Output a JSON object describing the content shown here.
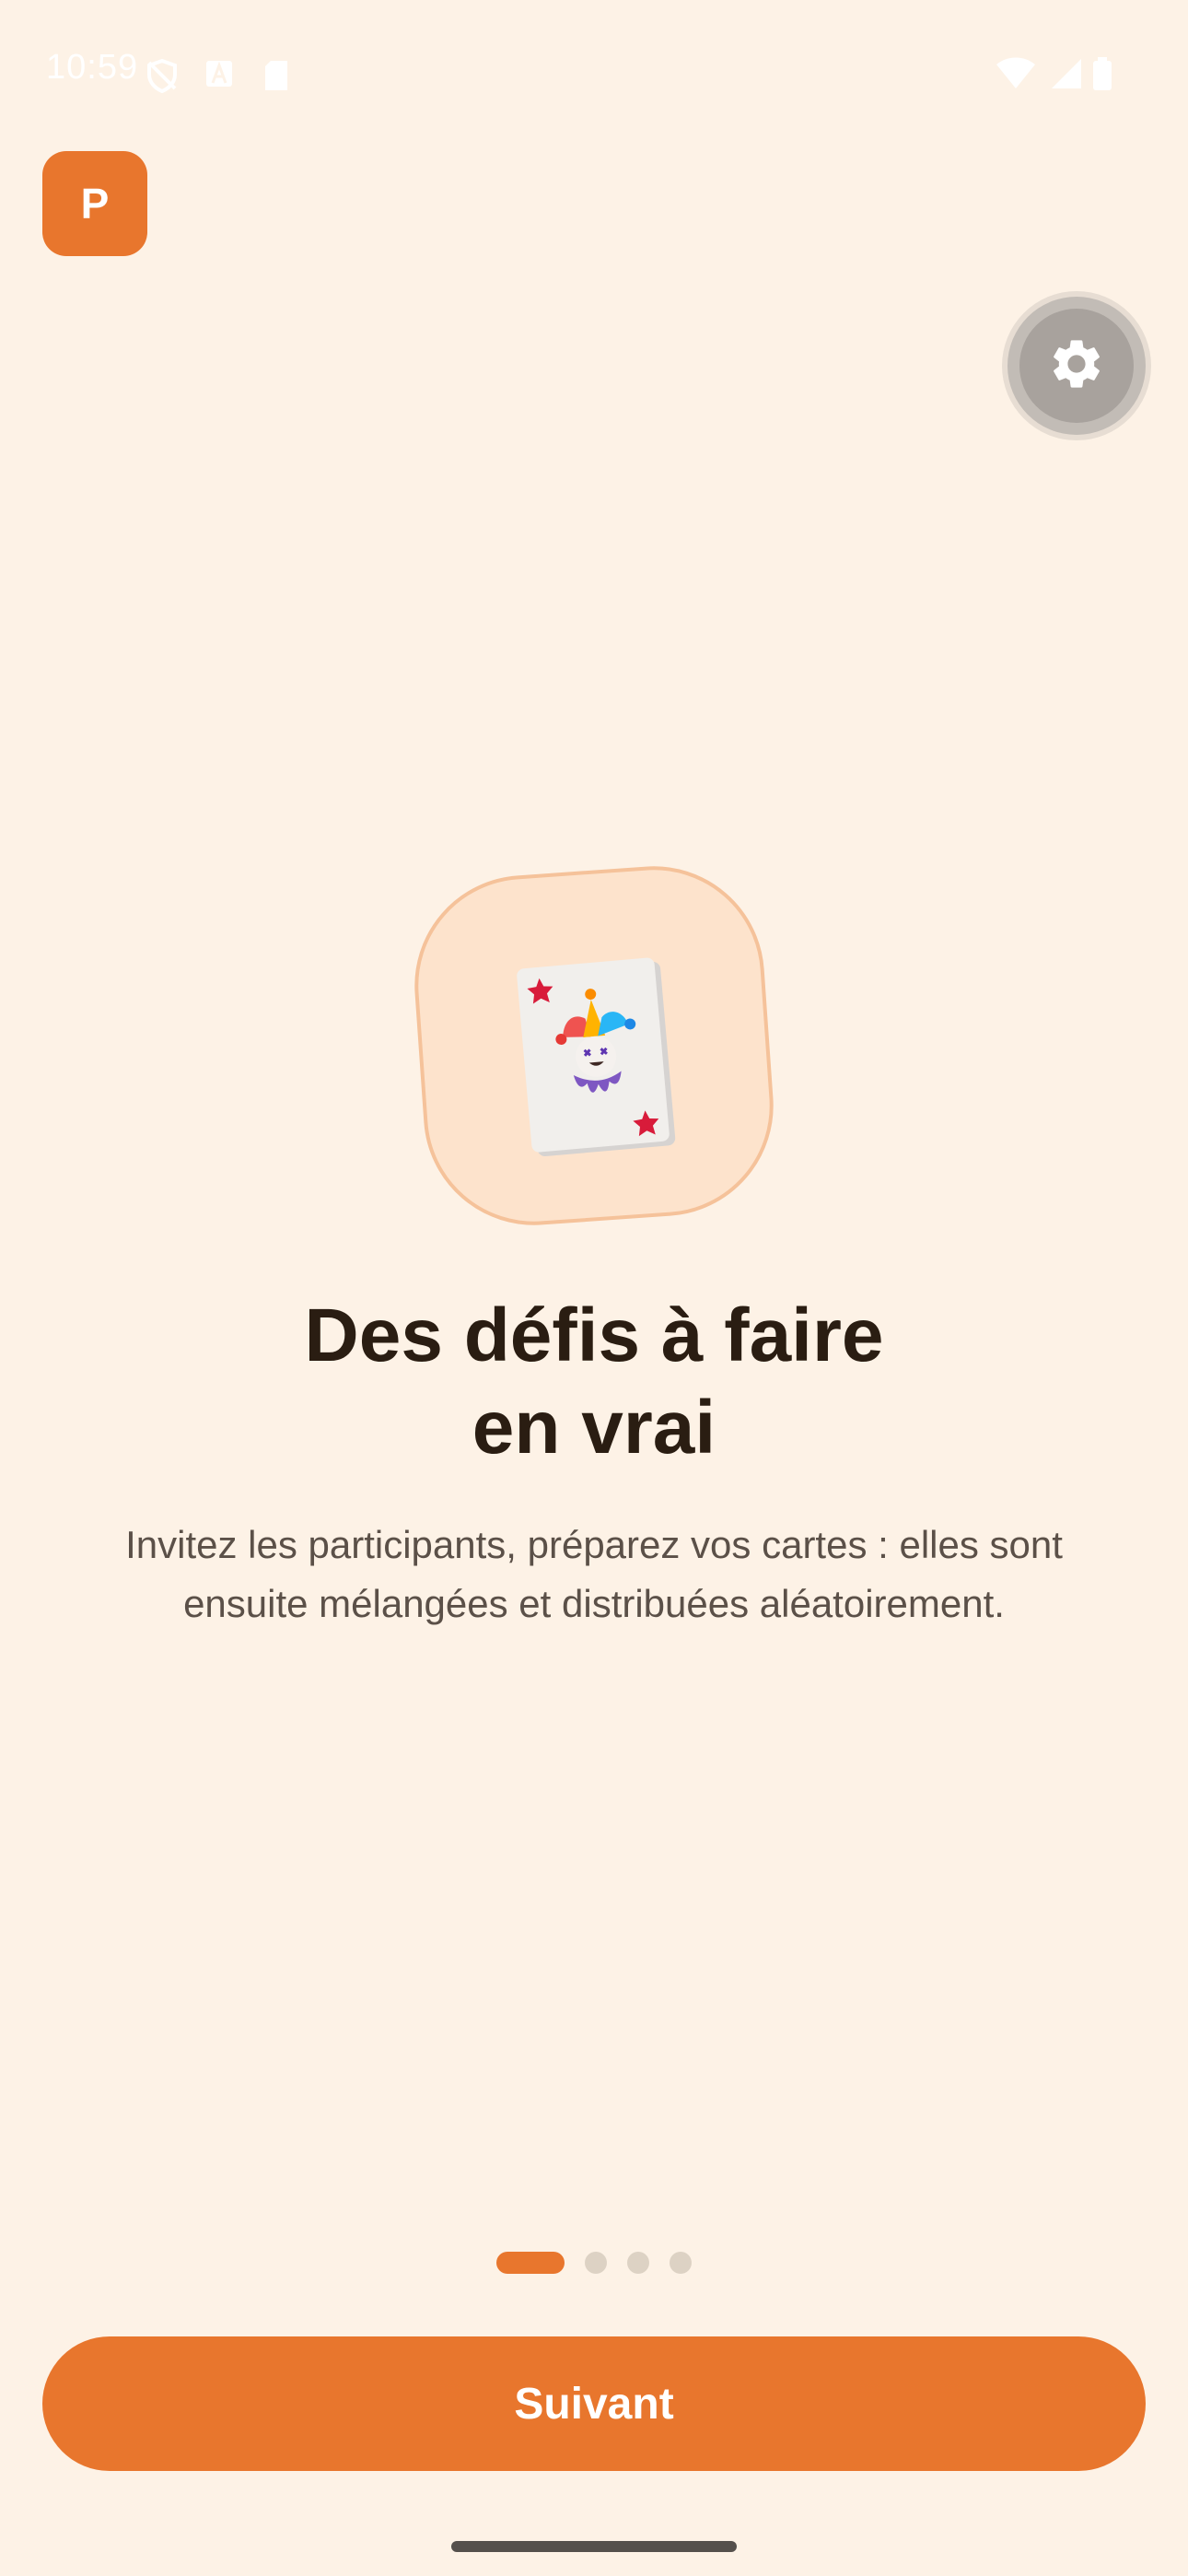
{
  "status_bar": {
    "time": "10:59",
    "icons": [
      "shield-off-icon",
      "a-font-icon",
      "sim-card-icon",
      "wifi-icon",
      "signal-icon",
      "battery-icon"
    ]
  },
  "app_badge": {
    "letter": "P",
    "color": "#e8762d"
  },
  "settings": {
    "icon": "gear-icon"
  },
  "illustration": {
    "icon": "joker-card-icon"
  },
  "onboarding": {
    "title_line1": "Des défis à faire",
    "title_line2": "en vrai",
    "description": "Invitez les participants, préparez vos cartes : elles sont ensuite mélangées et distribuées aléatoirement.",
    "page_count": 4,
    "current_page": 1
  },
  "actions": {
    "next_label": "Suivant"
  },
  "colors": {
    "background": "#fdf2e6",
    "accent": "#e8762d",
    "title": "#2a1d12",
    "body": "#5b5048"
  }
}
